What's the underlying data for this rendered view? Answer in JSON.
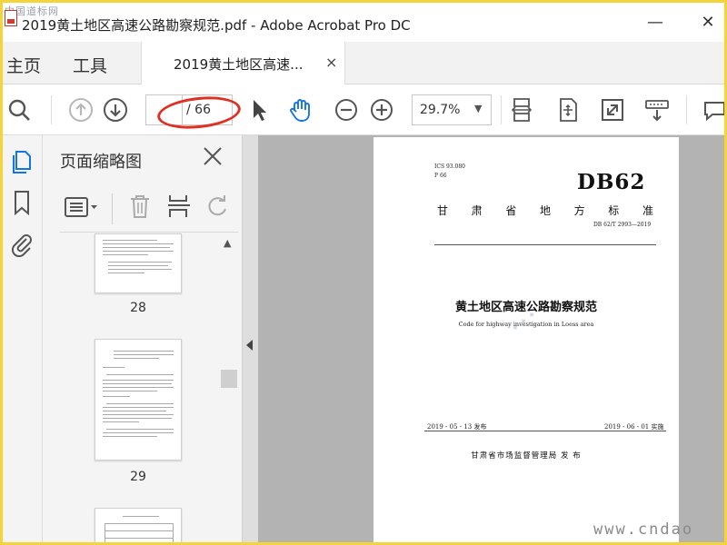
{
  "window": {
    "title": "2019黄土地区高速公路勘察规范.pdf - Adobe Acrobat Pro DC",
    "top_watermark": "中国道标网",
    "minimize_symbol": "—",
    "close_symbol": "✕"
  },
  "tabs": {
    "home_label": "主页",
    "tools_label": "工具",
    "document_tab_label": "2019黄土地区高速...",
    "document_tab_close": "×"
  },
  "toolbar": {
    "page_count": "/ 66",
    "zoom_value": "29.7%",
    "zoom_caret": "▼"
  },
  "thumbnail_panel": {
    "title": "页面缩略图",
    "page_labels": [
      "28",
      "29"
    ],
    "scroll_up_symbol": "▲"
  },
  "document": {
    "ics_line": "ICS  93.080",
    "category_line": "P  66",
    "db_code": "DB62",
    "std_name_chars": [
      "甘",
      "肃",
      "省",
      "地",
      "方",
      "标",
      "准"
    ],
    "std_number": "DB 62/T 2993—2019",
    "title_cn": "黄土地区高速公路勘察规范",
    "title_en": "Code for highway investigation in Loess area",
    "publish_date": "2019 - 05 - 13 发布",
    "implement_date": "2019 - 06 - 01 实施",
    "issuer": "甘肃省市场监督管理局    发 布"
  },
  "watermarks": {
    "corner": "www.cndao"
  },
  "colors": {
    "highlight_ellipse": "#e03023",
    "hand_tool_active": "#1473e6",
    "frame_border": "#f5d33a",
    "document_background": "#b3b3b3"
  },
  "icons": [
    "search-icon",
    "previous-page-icon",
    "next-page-icon",
    "select-arrow-icon",
    "hand-tool-icon",
    "zoom-out-icon",
    "zoom-in-icon",
    "fit-width-icon",
    "fit-page-icon",
    "full-screen-icon",
    "scroll-mode-icon",
    "comment-icon",
    "page-thumbnails-icon",
    "bookmarks-icon",
    "attachments-icon",
    "thumbnail-options-icon",
    "delete-page-icon",
    "insert-page-icon",
    "rotate-page-icon",
    "close-icon"
  ]
}
